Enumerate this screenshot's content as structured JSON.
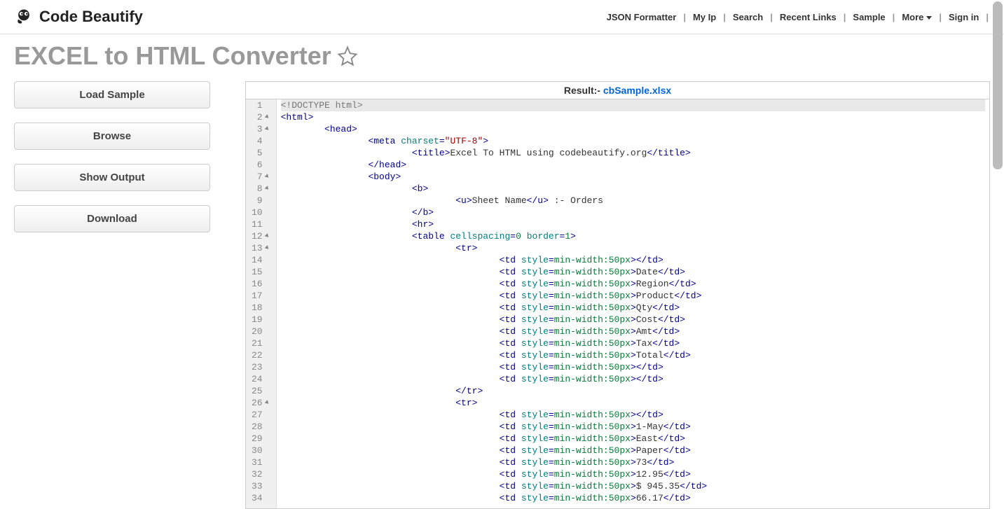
{
  "header": {
    "logo_text": "Code Beautify",
    "nav": {
      "json_formatter": "JSON Formatter",
      "my_ip": "My Ip",
      "search": "Search",
      "recent_links": "Recent Links",
      "sample": "Sample",
      "more": "More",
      "sign_in": "Sign in"
    }
  },
  "page_title": "EXCEL to HTML Converter",
  "sidebar": {
    "load_sample": "Load Sample",
    "browse": "Browse",
    "show_output": "Show Output",
    "download": "Download"
  },
  "result": {
    "label": "Result:- ",
    "filename": "cbSample.xlsx"
  },
  "code": {
    "lines": [
      {
        "n": 1,
        "fold": false,
        "indent": 0,
        "tokens": [
          {
            "c": "t-doctype",
            "t": "<!DOCTYPE html>"
          }
        ],
        "hl": true
      },
      {
        "n": 2,
        "fold": true,
        "indent": 0,
        "tokens": [
          {
            "c": "t-tag",
            "t": "<html>"
          }
        ]
      },
      {
        "n": 3,
        "fold": true,
        "indent": 2,
        "tokens": [
          {
            "c": "t-tag",
            "t": "<head>"
          }
        ]
      },
      {
        "n": 4,
        "fold": false,
        "indent": 4,
        "tokens": [
          {
            "c": "t-tag",
            "t": "<meta "
          },
          {
            "c": "t-attr",
            "t": "charset"
          },
          {
            "c": "t-tag",
            "t": "="
          },
          {
            "c": "t-str",
            "t": "\"UTF-8\""
          },
          {
            "c": "t-tag",
            "t": ">"
          }
        ]
      },
      {
        "n": 5,
        "fold": false,
        "indent": 6,
        "tokens": [
          {
            "c": "t-tag",
            "t": "<title>"
          },
          {
            "c": "",
            "t": "Excel To HTML using codebeautify.org"
          },
          {
            "c": "t-tag",
            "t": "</title>"
          }
        ]
      },
      {
        "n": 6,
        "fold": false,
        "indent": 4,
        "tokens": [
          {
            "c": "t-tag",
            "t": "</head>"
          }
        ]
      },
      {
        "n": 7,
        "fold": true,
        "indent": 4,
        "tokens": [
          {
            "c": "t-tag",
            "t": "<body>"
          }
        ]
      },
      {
        "n": 8,
        "fold": true,
        "indent": 6,
        "tokens": [
          {
            "c": "t-tag",
            "t": "<b>"
          }
        ]
      },
      {
        "n": 9,
        "fold": false,
        "indent": 8,
        "tokens": [
          {
            "c": "t-tag",
            "t": "<u>"
          },
          {
            "c": "",
            "t": "Sheet Name"
          },
          {
            "c": "t-tag",
            "t": "</u>"
          },
          {
            "c": "",
            "t": " :- Orders"
          }
        ]
      },
      {
        "n": 10,
        "fold": false,
        "indent": 6,
        "tokens": [
          {
            "c": "t-tag",
            "t": "</b>"
          }
        ]
      },
      {
        "n": 11,
        "fold": false,
        "indent": 6,
        "tokens": [
          {
            "c": "t-tag",
            "t": "<hr>"
          }
        ]
      },
      {
        "n": 12,
        "fold": true,
        "indent": 6,
        "tokens": [
          {
            "c": "t-tag",
            "t": "<table "
          },
          {
            "c": "t-attr",
            "t": "cellspacing"
          },
          {
            "c": "t-tag",
            "t": "="
          },
          {
            "c": "t-val",
            "t": "0"
          },
          {
            "c": "t-tag",
            "t": " "
          },
          {
            "c": "t-attr",
            "t": "border"
          },
          {
            "c": "t-tag",
            "t": "="
          },
          {
            "c": "t-val",
            "t": "1"
          },
          {
            "c": "t-tag",
            "t": ">"
          }
        ]
      },
      {
        "n": 13,
        "fold": true,
        "indent": 8,
        "tokens": [
          {
            "c": "t-tag",
            "t": "<tr>"
          }
        ]
      },
      {
        "n": 14,
        "fold": false,
        "indent": 10,
        "tokens": [
          {
            "c": "t-tag",
            "t": "<td "
          },
          {
            "c": "t-attr",
            "t": "style"
          },
          {
            "c": "t-tag",
            "t": "="
          },
          {
            "c": "t-val",
            "t": "min-width:50px"
          },
          {
            "c": "t-tag",
            "t": "></td>"
          }
        ]
      },
      {
        "n": 15,
        "fold": false,
        "indent": 10,
        "tokens": [
          {
            "c": "t-tag",
            "t": "<td "
          },
          {
            "c": "t-attr",
            "t": "style"
          },
          {
            "c": "t-tag",
            "t": "="
          },
          {
            "c": "t-val",
            "t": "min-width:50px"
          },
          {
            "c": "t-tag",
            "t": ">"
          },
          {
            "c": "",
            "t": "Date"
          },
          {
            "c": "t-tag",
            "t": "</td>"
          }
        ]
      },
      {
        "n": 16,
        "fold": false,
        "indent": 10,
        "tokens": [
          {
            "c": "t-tag",
            "t": "<td "
          },
          {
            "c": "t-attr",
            "t": "style"
          },
          {
            "c": "t-tag",
            "t": "="
          },
          {
            "c": "t-val",
            "t": "min-width:50px"
          },
          {
            "c": "t-tag",
            "t": ">"
          },
          {
            "c": "",
            "t": "Region"
          },
          {
            "c": "t-tag",
            "t": "</td>"
          }
        ]
      },
      {
        "n": 17,
        "fold": false,
        "indent": 10,
        "tokens": [
          {
            "c": "t-tag",
            "t": "<td "
          },
          {
            "c": "t-attr",
            "t": "style"
          },
          {
            "c": "t-tag",
            "t": "="
          },
          {
            "c": "t-val",
            "t": "min-width:50px"
          },
          {
            "c": "t-tag",
            "t": ">"
          },
          {
            "c": "",
            "t": "Product"
          },
          {
            "c": "t-tag",
            "t": "</td>"
          }
        ]
      },
      {
        "n": 18,
        "fold": false,
        "indent": 10,
        "tokens": [
          {
            "c": "t-tag",
            "t": "<td "
          },
          {
            "c": "t-attr",
            "t": "style"
          },
          {
            "c": "t-tag",
            "t": "="
          },
          {
            "c": "t-val",
            "t": "min-width:50px"
          },
          {
            "c": "t-tag",
            "t": ">"
          },
          {
            "c": "",
            "t": "Qty"
          },
          {
            "c": "t-tag",
            "t": "</td>"
          }
        ]
      },
      {
        "n": 19,
        "fold": false,
        "indent": 10,
        "tokens": [
          {
            "c": "t-tag",
            "t": "<td "
          },
          {
            "c": "t-attr",
            "t": "style"
          },
          {
            "c": "t-tag",
            "t": "="
          },
          {
            "c": "t-val",
            "t": "min-width:50px"
          },
          {
            "c": "t-tag",
            "t": ">"
          },
          {
            "c": "",
            "t": "Cost"
          },
          {
            "c": "t-tag",
            "t": "</td>"
          }
        ]
      },
      {
        "n": 20,
        "fold": false,
        "indent": 10,
        "tokens": [
          {
            "c": "t-tag",
            "t": "<td "
          },
          {
            "c": "t-attr",
            "t": "style"
          },
          {
            "c": "t-tag",
            "t": "="
          },
          {
            "c": "t-val",
            "t": "min-width:50px"
          },
          {
            "c": "t-tag",
            "t": ">"
          },
          {
            "c": "",
            "t": "Amt"
          },
          {
            "c": "t-tag",
            "t": "</td>"
          }
        ]
      },
      {
        "n": 21,
        "fold": false,
        "indent": 10,
        "tokens": [
          {
            "c": "t-tag",
            "t": "<td "
          },
          {
            "c": "t-attr",
            "t": "style"
          },
          {
            "c": "t-tag",
            "t": "="
          },
          {
            "c": "t-val",
            "t": "min-width:50px"
          },
          {
            "c": "t-tag",
            "t": ">"
          },
          {
            "c": "",
            "t": "Tax"
          },
          {
            "c": "t-tag",
            "t": "</td>"
          }
        ]
      },
      {
        "n": 22,
        "fold": false,
        "indent": 10,
        "tokens": [
          {
            "c": "t-tag",
            "t": "<td "
          },
          {
            "c": "t-attr",
            "t": "style"
          },
          {
            "c": "t-tag",
            "t": "="
          },
          {
            "c": "t-val",
            "t": "min-width:50px"
          },
          {
            "c": "t-tag",
            "t": ">"
          },
          {
            "c": "",
            "t": "Total"
          },
          {
            "c": "t-tag",
            "t": "</td>"
          }
        ]
      },
      {
        "n": 23,
        "fold": false,
        "indent": 10,
        "tokens": [
          {
            "c": "t-tag",
            "t": "<td "
          },
          {
            "c": "t-attr",
            "t": "style"
          },
          {
            "c": "t-tag",
            "t": "="
          },
          {
            "c": "t-val",
            "t": "min-width:50px"
          },
          {
            "c": "t-tag",
            "t": "></td>"
          }
        ]
      },
      {
        "n": 24,
        "fold": false,
        "indent": 10,
        "tokens": [
          {
            "c": "t-tag",
            "t": "<td "
          },
          {
            "c": "t-attr",
            "t": "style"
          },
          {
            "c": "t-tag",
            "t": "="
          },
          {
            "c": "t-val",
            "t": "min-width:50px"
          },
          {
            "c": "t-tag",
            "t": "></td>"
          }
        ]
      },
      {
        "n": 25,
        "fold": false,
        "indent": 8,
        "tokens": [
          {
            "c": "t-tag",
            "t": "</tr>"
          }
        ]
      },
      {
        "n": 26,
        "fold": true,
        "indent": 8,
        "tokens": [
          {
            "c": "t-tag",
            "t": "<tr>"
          }
        ]
      },
      {
        "n": 27,
        "fold": false,
        "indent": 10,
        "tokens": [
          {
            "c": "t-tag",
            "t": "<td "
          },
          {
            "c": "t-attr",
            "t": "style"
          },
          {
            "c": "t-tag",
            "t": "="
          },
          {
            "c": "t-val",
            "t": "min-width:50px"
          },
          {
            "c": "t-tag",
            "t": "></td>"
          }
        ]
      },
      {
        "n": 28,
        "fold": false,
        "indent": 10,
        "tokens": [
          {
            "c": "t-tag",
            "t": "<td "
          },
          {
            "c": "t-attr",
            "t": "style"
          },
          {
            "c": "t-tag",
            "t": "="
          },
          {
            "c": "t-val",
            "t": "min-width:50px"
          },
          {
            "c": "t-tag",
            "t": ">"
          },
          {
            "c": "",
            "t": "1-May"
          },
          {
            "c": "t-tag",
            "t": "</td>"
          }
        ]
      },
      {
        "n": 29,
        "fold": false,
        "indent": 10,
        "tokens": [
          {
            "c": "t-tag",
            "t": "<td "
          },
          {
            "c": "t-attr",
            "t": "style"
          },
          {
            "c": "t-tag",
            "t": "="
          },
          {
            "c": "t-val",
            "t": "min-width:50px"
          },
          {
            "c": "t-tag",
            "t": ">"
          },
          {
            "c": "",
            "t": "East"
          },
          {
            "c": "t-tag",
            "t": "</td>"
          }
        ]
      },
      {
        "n": 30,
        "fold": false,
        "indent": 10,
        "tokens": [
          {
            "c": "t-tag",
            "t": "<td "
          },
          {
            "c": "t-attr",
            "t": "style"
          },
          {
            "c": "t-tag",
            "t": "="
          },
          {
            "c": "t-val",
            "t": "min-width:50px"
          },
          {
            "c": "t-tag",
            "t": ">"
          },
          {
            "c": "",
            "t": "Paper"
          },
          {
            "c": "t-tag",
            "t": "</td>"
          }
        ]
      },
      {
        "n": 31,
        "fold": false,
        "indent": 10,
        "tokens": [
          {
            "c": "t-tag",
            "t": "<td "
          },
          {
            "c": "t-attr",
            "t": "style"
          },
          {
            "c": "t-tag",
            "t": "="
          },
          {
            "c": "t-val",
            "t": "min-width:50px"
          },
          {
            "c": "t-tag",
            "t": ">"
          },
          {
            "c": "",
            "t": "73"
          },
          {
            "c": "t-tag",
            "t": "</td>"
          }
        ]
      },
      {
        "n": 32,
        "fold": false,
        "indent": 10,
        "tokens": [
          {
            "c": "t-tag",
            "t": "<td "
          },
          {
            "c": "t-attr",
            "t": "style"
          },
          {
            "c": "t-tag",
            "t": "="
          },
          {
            "c": "t-val",
            "t": "min-width:50px"
          },
          {
            "c": "t-tag",
            "t": ">"
          },
          {
            "c": "",
            "t": "12.95"
          },
          {
            "c": "t-tag",
            "t": "</td>"
          }
        ]
      },
      {
        "n": 33,
        "fold": false,
        "indent": 10,
        "tokens": [
          {
            "c": "t-tag",
            "t": "<td "
          },
          {
            "c": "t-attr",
            "t": "style"
          },
          {
            "c": "t-tag",
            "t": "="
          },
          {
            "c": "t-val",
            "t": "min-width:50px"
          },
          {
            "c": "t-tag",
            "t": ">"
          },
          {
            "c": "",
            "t": "$ 945.35"
          },
          {
            "c": "t-tag",
            "t": "</td>"
          }
        ]
      },
      {
        "n": 34,
        "fold": false,
        "indent": 10,
        "tokens": [
          {
            "c": "t-tag",
            "t": "<td "
          },
          {
            "c": "t-attr",
            "t": "style"
          },
          {
            "c": "t-tag",
            "t": "="
          },
          {
            "c": "t-val",
            "t": "min-width:50px"
          },
          {
            "c": "t-tag",
            "t": ">"
          },
          {
            "c": "",
            "t": "66.17"
          },
          {
            "c": "t-tag",
            "t": "</td>"
          }
        ]
      }
    ]
  }
}
